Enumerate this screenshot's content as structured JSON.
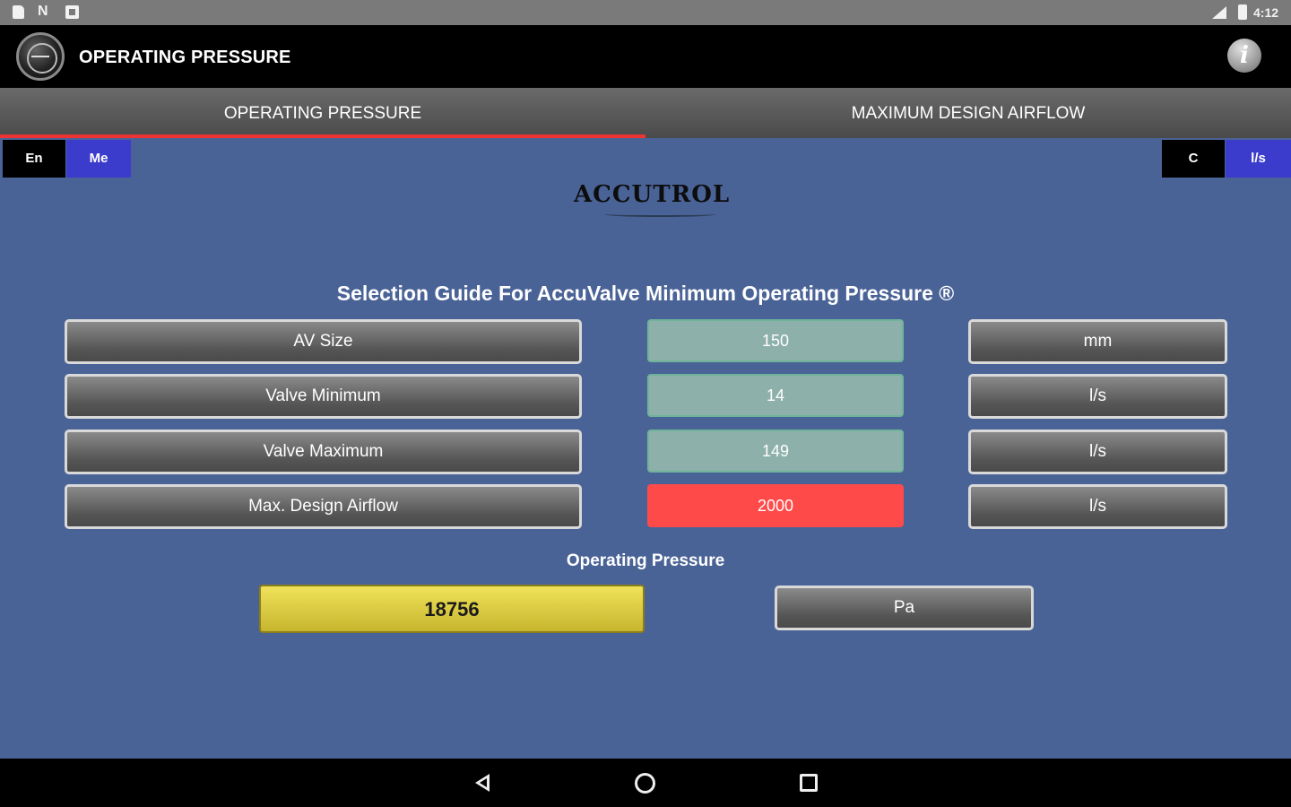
{
  "status_bar": {
    "time": "4:12",
    "icons": [
      "clipboard-icon",
      "n-icon",
      "square-notification-icon",
      "signal-icon",
      "battery-icon"
    ]
  },
  "app_bar": {
    "title": "OPERATING PRESSURE",
    "logo_icon": "gauge-icon",
    "info_icon": "info-icon",
    "info_glyph": "i"
  },
  "tabs": [
    {
      "label": "OPERATING PRESSURE",
      "active": true
    },
    {
      "label": "MAXIMUM DESIGN AIRFLOW",
      "active": false
    }
  ],
  "toggles": {
    "left": [
      {
        "label": "En"
      },
      {
        "label": "Me"
      }
    ],
    "right": [
      {
        "label": "C"
      },
      {
        "label": "l/s"
      }
    ]
  },
  "brand": {
    "name": "ACCUTROL"
  },
  "guide": {
    "title": "Selection Guide For AccuValve Minimum Operating Pressure ®"
  },
  "rows": [
    {
      "label": "AV Size",
      "value": "150",
      "unit": "mm"
    },
    {
      "label": "Valve Minimum",
      "value": "14",
      "unit": "l/s"
    },
    {
      "label": "Valve Maximum",
      "value": "149",
      "unit": "l/s"
    },
    {
      "label": "Max. Design Airflow",
      "value": "2000",
      "unit": "l/s"
    }
  ],
  "result": {
    "label": "Operating Pressure",
    "value": "18756",
    "unit": "Pa"
  },
  "colors": {
    "background": "#4a6397",
    "tab_indicator": "#e33333",
    "toggle_active": "#3c3ccc",
    "value_box": "#8db0aa",
    "alert": "#ff4a4a",
    "result": "#e6d64a"
  },
  "nav_bar": {
    "icons": [
      "back-icon",
      "home-icon",
      "recent-apps-icon"
    ]
  }
}
